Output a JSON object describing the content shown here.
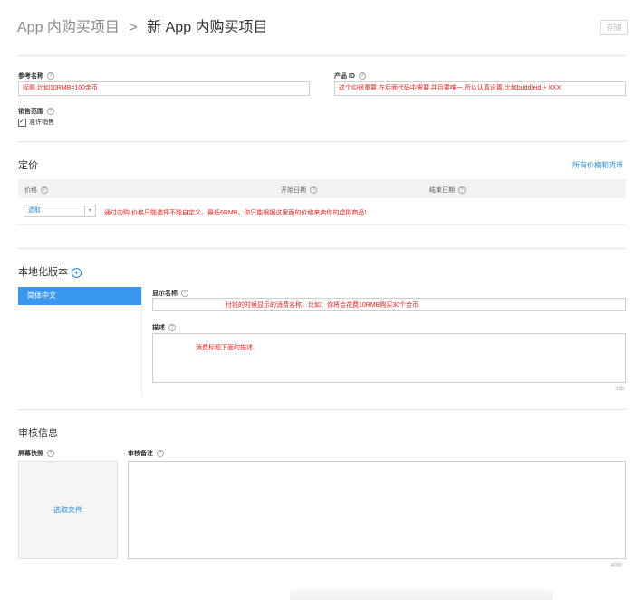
{
  "header": {
    "breadcrumb_parent": "App 内购买项目",
    "breadcrumb_sep": ">",
    "breadcrumb_current": "新 App 内购买项目",
    "save_label": "存储"
  },
  "product": {
    "ref_name_label": "参考名称",
    "ref_name_value": "标题,比如10RMB=100金币",
    "product_id_label": "产品 ID",
    "product_id_value": "这个ID很重要,在后面代码中需要,并且要唯一,所以认真设置,比如buddleid + XXX",
    "sale_range_label": "销售范围",
    "allow_sale_label": "准许销售"
  },
  "pricing": {
    "title": "定价",
    "all_prices_link": "所有价格和货币",
    "columns": [
      "价格",
      "开始日期",
      "结束日期"
    ],
    "select_value": "选取",
    "note": "通过内购,价格只能选择不能自定义。最低6RMB。你只能根据这里面的价格来卖你的虚拟商品!"
  },
  "localization": {
    "title": "本地化版本",
    "locale_item": "简体中文",
    "display_name_label": "显示名称",
    "display_name_note": "付钱的时候显示的消费名称，比如：你将会花费10RMB购买30个金币",
    "desc_label": "描述",
    "desc_note": "消费标题下面的描述.",
    "desc_count": "255"
  },
  "review": {
    "title": "审核信息",
    "screenshot_label": "屏幕快照",
    "choose_file": "选取文件",
    "notes_label": "审核备注",
    "notes_count": "4000"
  },
  "help_glyph": "?",
  "plus_glyph": "+",
  "arrow_glyph": "▾",
  "colors": {
    "accent_blue": "#3b98f0",
    "link_blue": "#2a8ad4",
    "annotation_red": "#e02020"
  }
}
